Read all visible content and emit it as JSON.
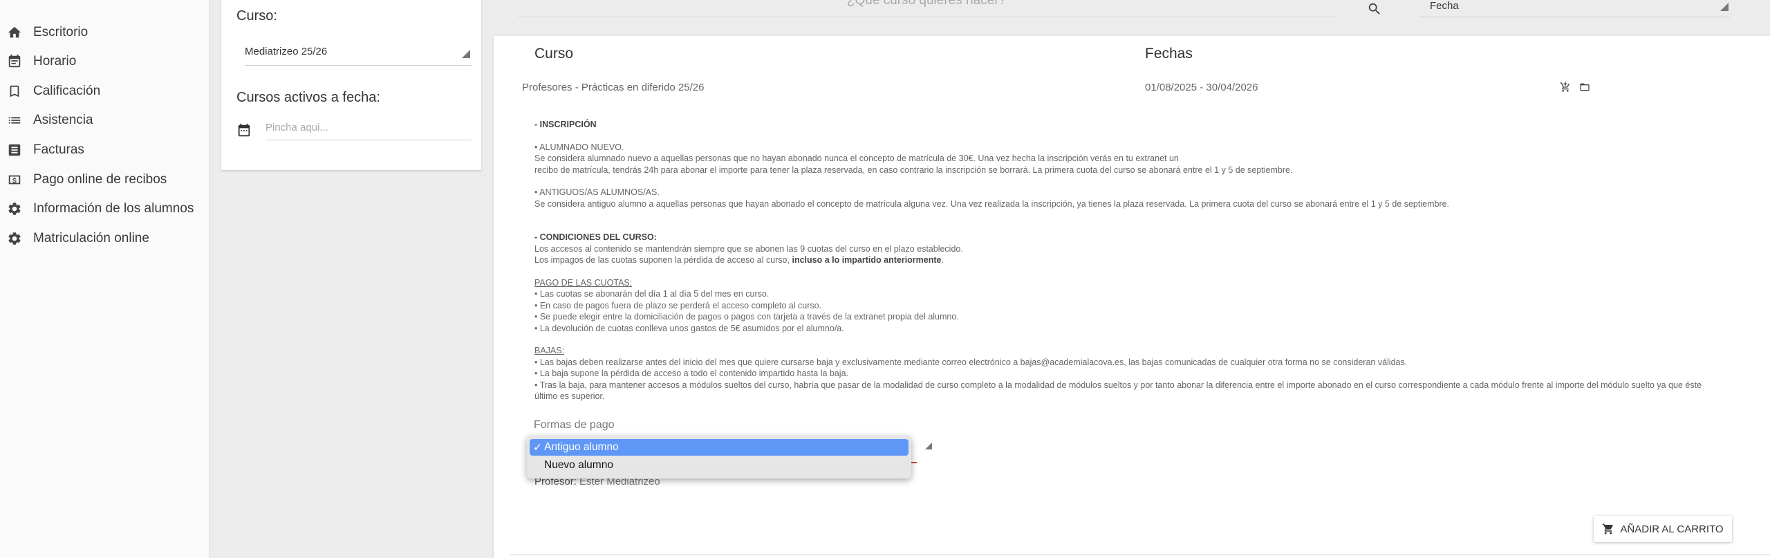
{
  "sidebar": {
    "items": [
      {
        "label": "Escritorio",
        "icon": "home-icon"
      },
      {
        "label": "Horario",
        "icon": "calendar-icon"
      },
      {
        "label": "Calificación",
        "icon": "bookmark-icon"
      },
      {
        "label": "Asistencia",
        "icon": "list-icon"
      },
      {
        "label": "Facturas",
        "icon": "receipt-icon"
      },
      {
        "label": "Pago online de recibos",
        "icon": "money-icon"
      },
      {
        "label": "Información de los alumnos",
        "icon": "gear-icon"
      },
      {
        "label": "Matriculación online",
        "icon": "gear-icon"
      }
    ]
  },
  "filters": {
    "curso_label": "Curso:",
    "curso_value": "Mediatrizeo 25/26",
    "activos_label": "Cursos activos a fecha:",
    "date_placeholder": "Pincha aqui..."
  },
  "search": {
    "placeholder": "¿Qué curso quieres hacer?",
    "sort_value": "Fecha"
  },
  "table": {
    "col_curso": "Curso",
    "col_fechas": "Fechas",
    "row": {
      "curso": "Profesores - Prácticas en diferido 25/26",
      "fechas": "01/08/2025 - 30/04/2026"
    }
  },
  "description": {
    "inscripcion_title": "- INSCRIPCIÓN",
    "nuevo_title": "• ALUMNADO NUEVO.",
    "nuevo_1": "Se considera alumnado nuevo a aquellas personas que no hayan abonado nunca el concepto de matrícula de 30€. Una vez hecha la inscripción verás en tu extranet un",
    "nuevo_2": "recibo de matrícula, tendrás 24h para abonar el importe para tener la plaza reservada, en caso contrario la inscripción se borrará. La primera cuota del curso se abonará entre el 1 y 5 de septiembre.",
    "antiguos_title": "• ANTIGUOS/AS ALUMNOS/AS.",
    "antiguos_1": "Se considera antiguo alumno a aquellas personas que hayan abonado el concepto de matrícula alguna vez. Una vez realizada la inscripción, ya tienes la plaza reservada. La primera cuota del curso se abonará entre el 1 y 5 de septiembre.",
    "condiciones_title": "- CONDICIONES DEL CURSO:",
    "condiciones_1": "Los accesos al contenido se mantendrán siempre que se abonen las 9 cuotas del curso en el plazo establecido.",
    "condiciones_2a": "Los impagos de las cuotas suponen la pérdida de acceso al curso, ",
    "condiciones_2b": "incluso a lo impartido anteriormente",
    "condiciones_2c": ".",
    "pago_title": "PAGO DE LAS CUOTAS:",
    "pago_1": "• Las cuotas se abonarán del día 1 al día 5 del mes en curso.",
    "pago_2": "• En caso de pagos fuera de plazo se perderá el acceso completo al curso.",
    "pago_3": "• Se puede elegir entre la domiciliación de pagos o pagos con tarjeta a través de la extranet propia del alumno.",
    "pago_4": "• La devolución de cuotas conlleva unos gastos de 5€ asumidos por el alumno/a.",
    "bajas_title": "BAJAS:",
    "bajas_1": "• Las bajas deben realizarse antes del inicio del mes que quiere cursarse baja y exclusivamente mediante correo electrónico a bajas@academialacova.es, las bajas comunicadas de cualquier otra forma no se consideran válidas.",
    "bajas_2": "• La baja supone la pérdida de acceso a todo el contenido impartido hasta la baja.",
    "bajas_3": "• Tras la baja, para mantener accesos a módulos sueltos del curso, habría que pasar de la modalidad de curso completo a la modalidad de módulos sueltos y por tanto abonar la diferencia entre el importe abonado en el curso correspondiente a cada módulo frente al importe del módulo suelto ya que éste último es superior."
  },
  "payment": {
    "label": "Formas de pago",
    "options": [
      "Antiguo alumno",
      "Nuevo alumno"
    ],
    "selected_check": "✓"
  },
  "profesor": {
    "label": "Profesor:",
    "name": " Ester Mediatrizeo"
  },
  "cart_button": "AÑADIR AL CARRITO",
  "colors": {
    "highlight": "#5f97f7",
    "error_underline": "#e53935"
  }
}
